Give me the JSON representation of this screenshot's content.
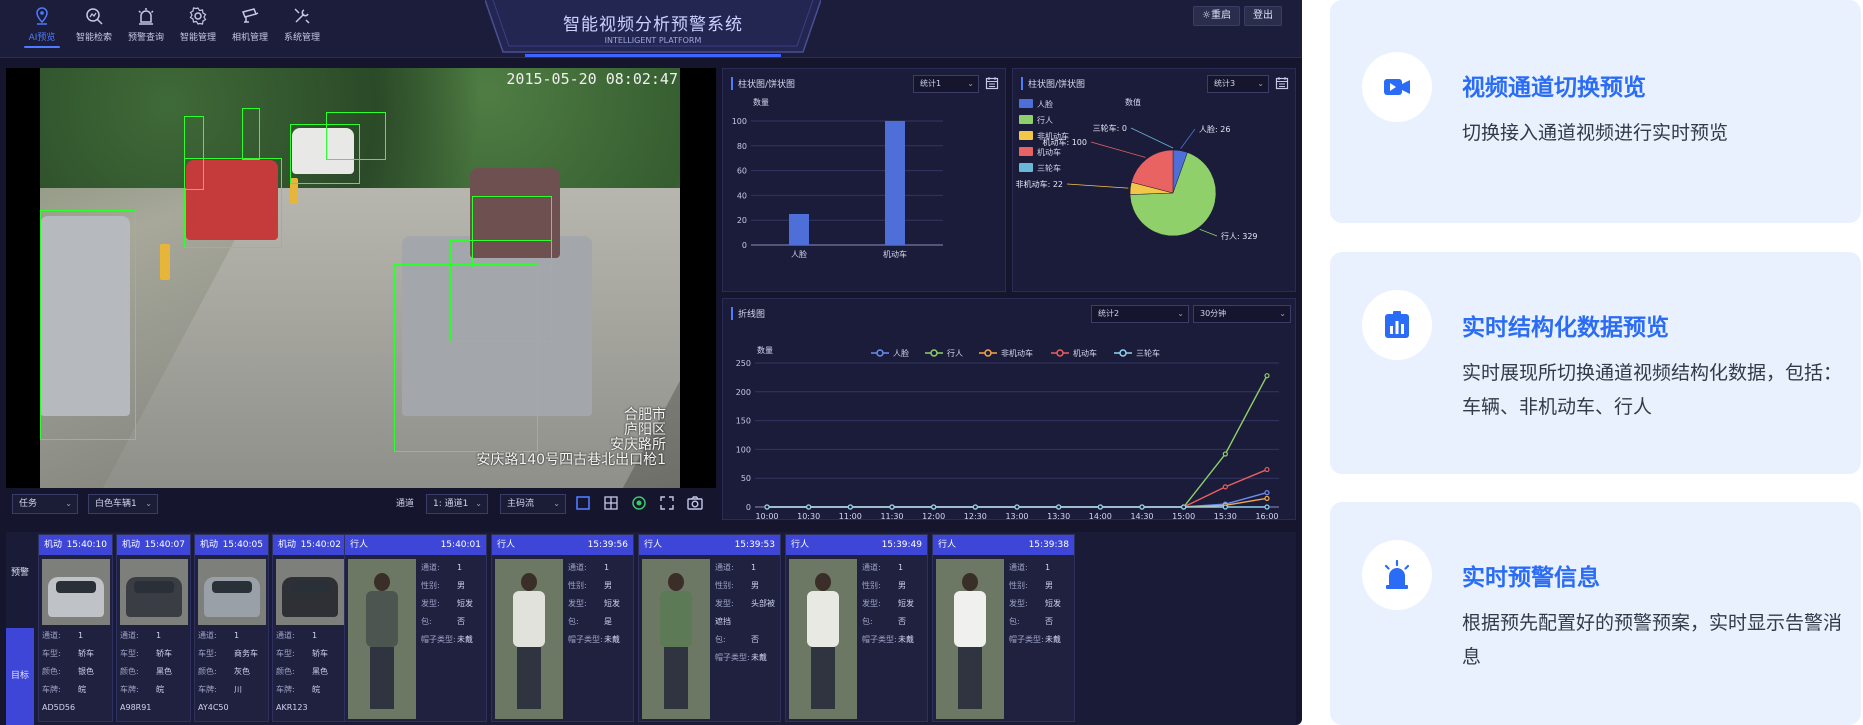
{
  "app": {
    "title": "智能视频分析预警系统",
    "subtitle": "INTELLIGENT PLATFORM",
    "nav": [
      {
        "label": "AI预览",
        "icon": "location-pin-icon",
        "active": true
      },
      {
        "label": "智能检索",
        "icon": "search-chart-icon",
        "active": false
      },
      {
        "label": "预警查询",
        "icon": "alarm-lamp-icon",
        "active": false
      },
      {
        "label": "智能管理",
        "icon": "gear-icon",
        "active": false
      },
      {
        "label": "相机管理",
        "icon": "camera-icon",
        "active": false
      },
      {
        "label": "系统管理",
        "icon": "tools-icon",
        "active": false
      }
    ],
    "buttons": {
      "restart": "重启",
      "logout": "登出"
    }
  },
  "video": {
    "timestamp": "2015-05-20 08:02:47",
    "location_lines": [
      "合肥市",
      "庐阳区",
      "安庆路所",
      "安庆路140号四古巷北出口枪1"
    ]
  },
  "controls": {
    "task": "任务",
    "vehicle": "白色车辆1",
    "channel_label": "通道",
    "channel": "1: 通道1",
    "stream": "主码流"
  },
  "bar_panel": {
    "title": "柱状图/饼状图",
    "select": "统计1",
    "chart_data": {
      "type": "bar",
      "categories": [
        "人脸",
        "机动车"
      ],
      "values": [
        25,
        100
      ],
      "ylabel": "数量",
      "ylim": [
        0,
        100
      ],
      "yticks": [
        0,
        20,
        40,
        60,
        80,
        100
      ],
      "color": "#4f6fd8"
    }
  },
  "pie_panel": {
    "title": "柱状图/饼状图",
    "select": "统计3",
    "legend_title": "数值",
    "chart_data": {
      "type": "pie",
      "labels": [
        "人脸",
        "行人",
        "非机动车",
        "机动车",
        "三轮车"
      ],
      "values": [
        26,
        329,
        22,
        100,
        0
      ],
      "colors": [
        "#4f6fd8",
        "#8fd06a",
        "#f3c64a",
        "#ea6363",
        "#6ab8d8"
      ],
      "slice_labels": [
        "人脸: 26",
        "行人: 329",
        "非机动车: 22",
        "机动车: 100",
        "三轮车: 0"
      ]
    }
  },
  "line_panel": {
    "title": "折线图",
    "select1": "统计2",
    "select2": "30分钟",
    "chart_data": {
      "type": "line",
      "ylabel": "数量",
      "ylim": [
        0,
        250
      ],
      "yticks": [
        0,
        50,
        100,
        150,
        200,
        250
      ],
      "x": [
        "10:00",
        "10:30",
        "11:00",
        "11:30",
        "12:00",
        "12:30",
        "13:00",
        "13:30",
        "14:00",
        "14:30",
        "15:00",
        "15:30",
        "16:00"
      ],
      "series": [
        {
          "name": "人脸",
          "color": "#6a8cf0",
          "values": [
            0,
            0,
            0,
            0,
            0,
            0,
            0,
            0,
            0,
            0,
            0,
            5,
            25
          ]
        },
        {
          "name": "行人",
          "color": "#8fd06a",
          "values": [
            0,
            0,
            0,
            0,
            0,
            0,
            0,
            0,
            0,
            0,
            0,
            92,
            228
          ]
        },
        {
          "name": "非机动车",
          "color": "#f3a64a",
          "values": [
            0,
            0,
            0,
            0,
            0,
            0,
            0,
            0,
            0,
            0,
            0,
            3,
            15
          ]
        },
        {
          "name": "机动车",
          "color": "#ea5f5f",
          "values": [
            0,
            0,
            0,
            0,
            0,
            0,
            0,
            0,
            0,
            0,
            0,
            35,
            65
          ]
        },
        {
          "name": "三轮车",
          "color": "#8fd3f0",
          "values": [
            0,
            0,
            0,
            0,
            0,
            0,
            0,
            0,
            0,
            0,
            0,
            0,
            0
          ]
        }
      ]
    }
  },
  "list": {
    "tabs": [
      "预警",
      "目标"
    ],
    "vehicle_keys": [
      "通道:",
      "车型:",
      "颜色:",
      "车牌:"
    ],
    "person_keys": [
      "通道:",
      "性别:",
      "发型:",
      "包:",
      "帽子类型:"
    ],
    "vehicles": [
      {
        "type": "机动车",
        "time": "15:40:10",
        "channel": "1",
        "model": "轿车",
        "color": "银色",
        "plate": "皖AD5D56",
        "car_color": "#bfc3c8"
      },
      {
        "type": "机动车",
        "time": "15:40:07",
        "channel": "1",
        "model": "轿车",
        "color": "黑色",
        "plate": "皖A98R91",
        "car_color": "#3a3d44"
      },
      {
        "type": "机动车",
        "time": "15:40:05",
        "channel": "1",
        "model": "商务车",
        "color": "灰色",
        "plate": "川AY4C50",
        "car_color": "#9aa0a8"
      },
      {
        "type": "机动车",
        "time": "15:40:02",
        "channel": "1",
        "model": "轿车",
        "color": "黑色",
        "plate": "皖AKR123",
        "car_color": "#2e3036"
      }
    ],
    "persons": [
      {
        "type": "行人",
        "time": "15:40:01",
        "channel": "1",
        "gender": "男",
        "hair": "短发",
        "bag": "否",
        "hat": "未戴",
        "shirt": "#4d5550"
      },
      {
        "type": "行人",
        "time": "15:39:56",
        "channel": "1",
        "gender": "男",
        "hair": "短发",
        "bag": "是",
        "hat": "未戴",
        "shirt": "#e2e2dc"
      },
      {
        "type": "行人",
        "time": "15:39:53",
        "channel": "1",
        "gender": "男",
        "hair": "头部被遮挡",
        "bag": "否",
        "hat": "未戴",
        "shirt": "#5b7a55"
      },
      {
        "type": "行人",
        "time": "15:39:49",
        "channel": "1",
        "gender": "男",
        "hair": "短发",
        "bag": "否",
        "hat": "未戴",
        "shirt": "#e9e9e4"
      },
      {
        "type": "行人",
        "time": "15:39:38",
        "channel": "1",
        "gender": "男",
        "hair": "短发",
        "bag": "否",
        "hat": "未戴",
        "shirt": "#f0f0ee"
      }
    ]
  },
  "features": [
    {
      "title": "视频通道切换预览",
      "desc": "切换接入通道视频进行实时预览",
      "icon": "video-camera-icon"
    },
    {
      "title": "实时结构化数据预览",
      "desc": "实时展现所切换通道视频结构化数据，包括：车辆、非机动车、行人",
      "icon": "data-chart-icon"
    },
    {
      "title": "实时预警信息",
      "desc": "根据预先配置好的预警预案，实时显示告警消息",
      "icon": "alarm-light-icon"
    }
  ],
  "colors": {
    "accent": "#2b6cf6",
    "app_bg": "#15162e",
    "tab_active": "#3e46d8",
    "bbox": "#2cff2c"
  }
}
